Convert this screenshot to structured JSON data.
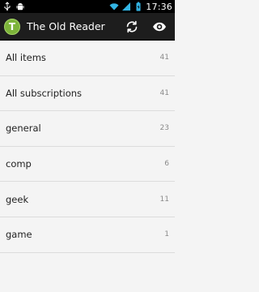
{
  "status_bar": {
    "left_icons": [
      "usb-icon",
      "android-debug-icon"
    ],
    "right_icons": [
      "wifi-icon",
      "signal-icon",
      "battery-icon"
    ],
    "time": "17:36"
  },
  "action_bar": {
    "logo_letter": "T",
    "title": "The Old Reader",
    "buttons": [
      {
        "icon": "refresh-icon"
      },
      {
        "icon": "eye-icon"
      }
    ]
  },
  "feeds": [
    {
      "label": "All items",
      "count": "41"
    },
    {
      "label": "All subscriptions",
      "count": "41"
    },
    {
      "label": "general",
      "count": "23"
    },
    {
      "label": "comp",
      "count": "6"
    },
    {
      "label": "geek",
      "count": "11"
    },
    {
      "label": "game",
      "count": "1"
    }
  ],
  "colors": {
    "action_bar_bg": "#1d1d1d",
    "logo_green": "#7db43a",
    "list_bg": "#f4f4f4",
    "divider": "#dcdcdc",
    "count_text": "#8a8a8a"
  }
}
